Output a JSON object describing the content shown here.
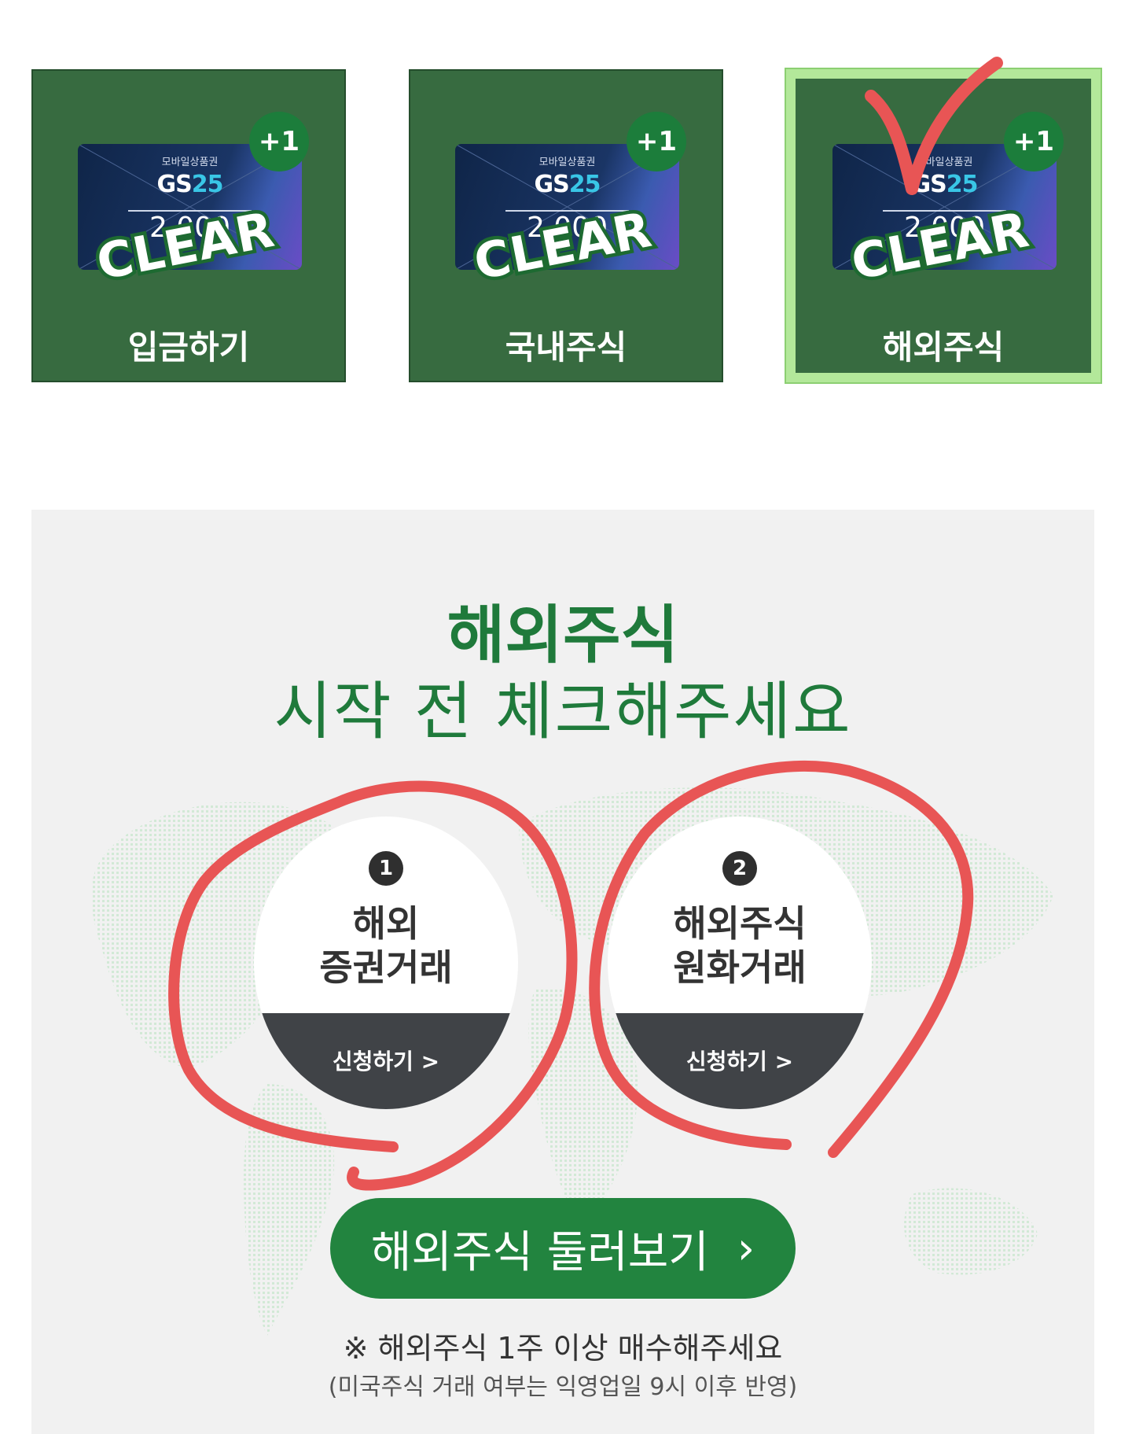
{
  "cards": [
    {
      "gift_top": "모바일상품권",
      "gift_brand_text": "GS",
      "gift_brand_num": "25",
      "gift_amount": "2,000",
      "badge": "+1",
      "stamp": "CLEAR",
      "label": "입금하기"
    },
    {
      "gift_top": "모바일상품권",
      "gift_brand_text": "GS",
      "gift_brand_num": "25",
      "gift_amount": "2,000",
      "badge": "+1",
      "stamp": "CLEAR",
      "label": "국내주식"
    },
    {
      "gift_top": "모바일상품권",
      "gift_brand_text": "GS",
      "gift_brand_num": "25",
      "gift_amount": "2,000",
      "badge": "+1",
      "stamp": "CLEAR",
      "label": "해외주식",
      "selected": true
    }
  ],
  "panel": {
    "headline_bold": "해외주식",
    "headline_regular": "시작 전 체크해주세요",
    "steps": [
      {
        "number": "1",
        "title_line1": "해외",
        "title_line2": "증권거래",
        "action": "신청하기 >"
      },
      {
        "number": "2",
        "title_line1": "해외주식",
        "title_line2": "원화거래",
        "action": "신청하기 >"
      }
    ],
    "browse_button": "해외주식 둘러보기",
    "browse_chevron": "›",
    "note_main": "※ 해외주식 1주 이상 매수해주세요",
    "note_sub": "(미국주식 거래 여부는 익영업일 9시 이후 반영)"
  },
  "colors": {
    "card_bg": "#376b40",
    "selected_border": "#b3e89a",
    "brand_green": "#1f7a3b",
    "button_green": "#22843f",
    "annotation_red": "#e85555"
  },
  "icons": {
    "check": "check-mark-icon",
    "chevron": "chevron-right-icon"
  }
}
